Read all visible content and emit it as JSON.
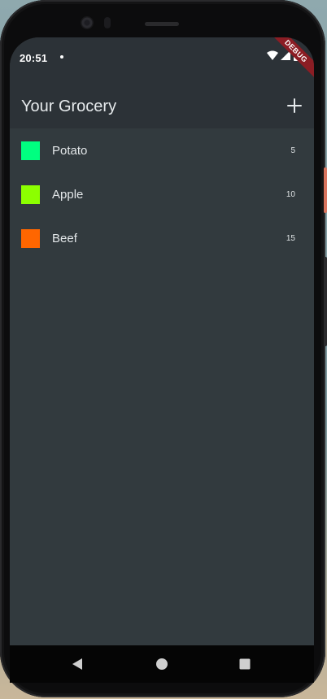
{
  "status_bar": {
    "time": "20:51",
    "debug_label": "DEBUG"
  },
  "app_bar": {
    "title": "Your Grocery",
    "add_icon": "plus-icon"
  },
  "groceries": [
    {
      "name": "Potato",
      "quantity": "5",
      "color": "#00ff80"
    },
    {
      "name": "Apple",
      "quantity": "10",
      "color": "#8cff00"
    },
    {
      "name": "Beef",
      "quantity": "15",
      "color": "#ff6600"
    }
  ],
  "nav_bar": {
    "back_icon": "triangle-back-icon",
    "home_icon": "circle-home-icon",
    "recents_icon": "square-recents-icon"
  },
  "colors": {
    "background": "#323a3e",
    "app_bar": "#2c3237",
    "debug_banner": "#8b1d24"
  }
}
